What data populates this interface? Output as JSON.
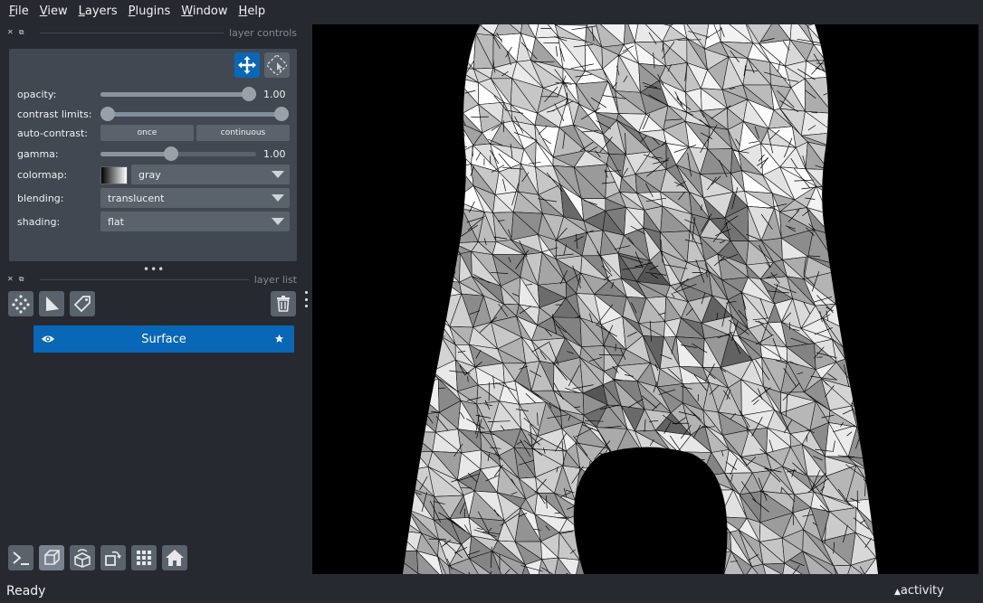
{
  "menu": {
    "items": [
      {
        "first": "F",
        "rest": "ile"
      },
      {
        "first": "V",
        "rest": "iew"
      },
      {
        "first": "L",
        "rest": "ayers"
      },
      {
        "first": "P",
        "rest": "lugins"
      },
      {
        "first": "W",
        "rest": "indow"
      },
      {
        "first": "H",
        "rest": "elp"
      }
    ]
  },
  "layer_controls": {
    "header": "layer controls",
    "opacity_label": "opacity:",
    "opacity_value": "1.00",
    "opacity_level": 1.0,
    "contrast_label": "contrast limits:",
    "auto_contrast_label": "auto-contrast:",
    "once_label": "once",
    "continuous_label": "continuous",
    "gamma_label": "gamma:",
    "gamma_value": "1.00",
    "colormap_label": "colormap:",
    "colormap_value": "gray",
    "blending_label": "blending:",
    "blending_value": "translucent",
    "shading_label": "shading:",
    "shading_value": "flat"
  },
  "layer_list": {
    "header": "layer list",
    "layers": [
      {
        "name": "Surface",
        "visible": true
      }
    ]
  },
  "status": {
    "text": "Ready",
    "activity": "activity"
  },
  "colors": {
    "background": "#262930",
    "panel": "#414851",
    "accent": "#0967b7",
    "control": "#5a626c"
  }
}
